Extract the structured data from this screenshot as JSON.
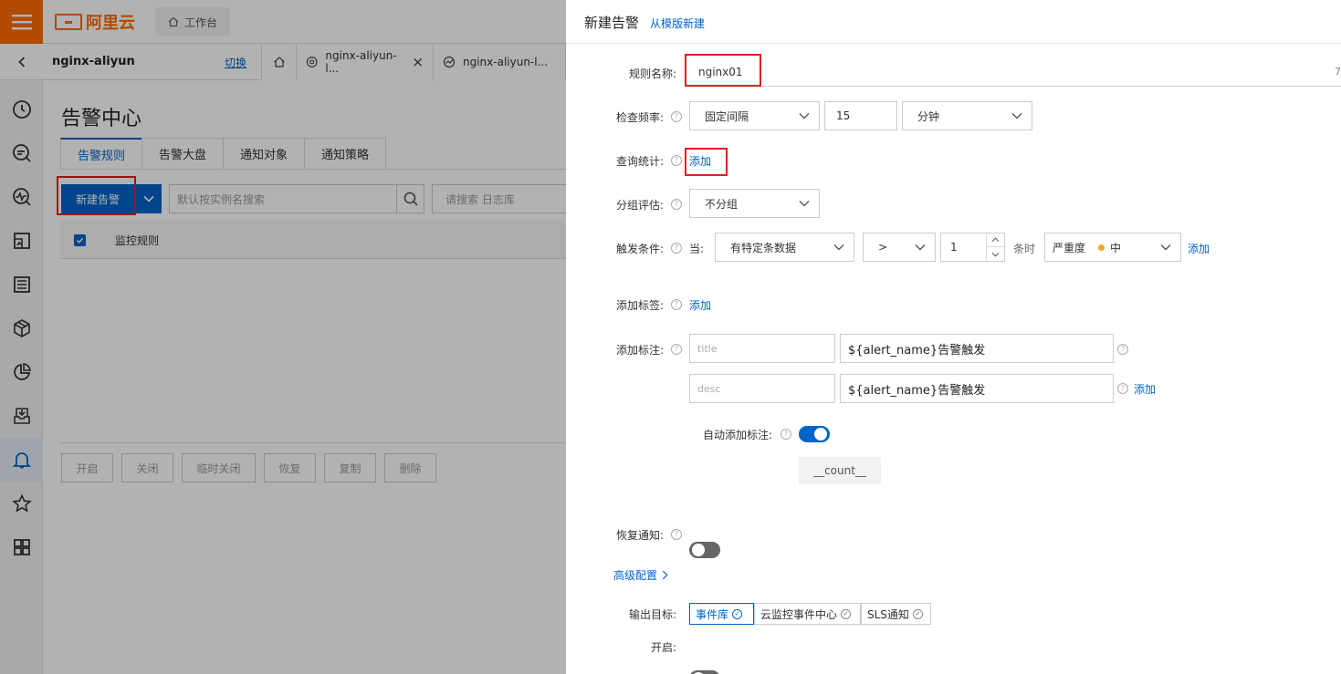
{
  "brand": {
    "logo_text": "阿里云",
    "accent": "#ff6a00",
    "primary": "#0064c8"
  },
  "topbar": {
    "workbench_label": "工作台"
  },
  "projbar": {
    "project_name": "nginx-aliyun",
    "switch_label": "切换",
    "tabs": [
      {
        "label": "nginx-aliyun-l...",
        "icon": "target-icon"
      },
      {
        "label": "nginx-aliyun-l...",
        "icon": "chart-icon"
      }
    ]
  },
  "sidenav": {
    "items": [
      "clock-icon",
      "search-log-icon",
      "monitor-search-icon",
      "dashboard-icon",
      "list-icon",
      "cube-icon",
      "pie-chart-icon",
      "import-icon",
      "bell-icon",
      "star-icon",
      "grid-icon"
    ]
  },
  "main": {
    "title": "告警中心",
    "tabs": [
      "告警规则",
      "告警大盘",
      "通知对象",
      "通知策略"
    ],
    "new_alert_label": "新建告警",
    "search_placeholder": "默认按实例名搜索",
    "search2_placeholder": "请搜索 日志库",
    "table_header": "监控规则",
    "actions": [
      "开启",
      "关闭",
      "临时关闭",
      "恢复",
      "复制",
      "删除"
    ]
  },
  "panel": {
    "title": "新建告警",
    "template_link": "从模版新建",
    "rule_name_label": "规则名称:",
    "rule_name_value": "nginx01",
    "rule_name_counter": "7",
    "check_freq_label": "检查频率:",
    "check_freq_type": "固定间隔",
    "check_freq_value": "15",
    "check_freq_unit": "分钟",
    "query_label": "查询统计:",
    "query_add": "添加",
    "group_label": "分组评估:",
    "group_value": "不分组",
    "trigger_label": "触发条件:",
    "trigger_when": "当:",
    "trigger_condition": "有特定条数据",
    "trigger_op": ">",
    "trigger_count": "1",
    "trigger_unit": "条时",
    "severity_label": "严重度",
    "severity_value": "中",
    "severity_color": "#f5a623",
    "trigger_add": "添加",
    "tag_label": "添加标签:",
    "tag_add": "添加",
    "annotation_label": "添加标注:",
    "annotations": [
      {
        "key": "title",
        "value": "${alert_name}告警触发"
      },
      {
        "key": "desc",
        "value": "${alert_name}告警触发"
      }
    ],
    "annotation_add": "添加",
    "auto_annotation_label": "自动添加标注:",
    "auto_annotation_on": true,
    "auto_tag": "__count__",
    "recover_label": "恢复通知:",
    "recover_on": false,
    "advanced_label": "高级配置",
    "output_label": "输出目标:",
    "outputs": [
      {
        "label": "事件库",
        "selected": true
      },
      {
        "label": "云监控事件中心",
        "selected": false
      },
      {
        "label": "SLS通知",
        "selected": false
      }
    ],
    "enable_label": "开启:",
    "enable_on": false
  }
}
